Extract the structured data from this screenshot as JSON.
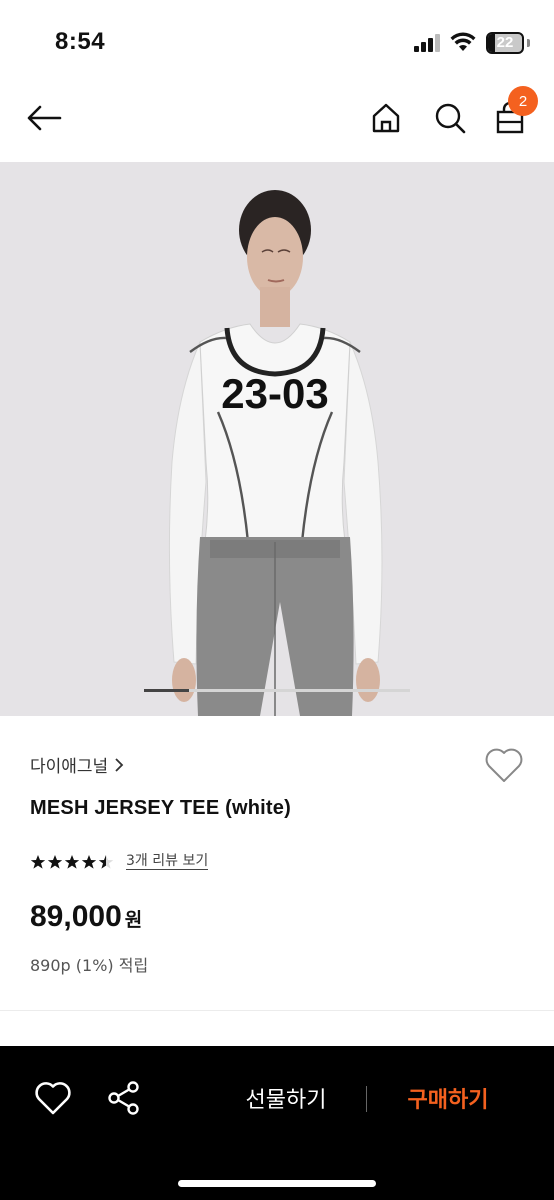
{
  "status_bar": {
    "time": "8:54",
    "battery": "22"
  },
  "nav": {
    "cart_count": "2",
    "icons": [
      "back-arrow-icon",
      "home-icon",
      "search-icon",
      "shopping-bag-icon"
    ]
  },
  "product": {
    "image_alt": "Model wearing white mesh long sleeve jersey tee with 23-03 print",
    "shirt_print": "23-03",
    "brand": "다이애그널",
    "title": "MESH JERSEY TEE (white)",
    "rating": 4.5,
    "review_link": "3개 리뷰 보기",
    "price": "89,000",
    "currency": "원",
    "points": "890p (1%) 적립"
  },
  "carousel": {
    "active_fraction": 0.17
  },
  "bottom_bar": {
    "gift_label": "선물하기",
    "buy_label": "구매하기"
  },
  "colors": {
    "accent": "#f4611f",
    "bottom_bar_bg": "#000000"
  }
}
